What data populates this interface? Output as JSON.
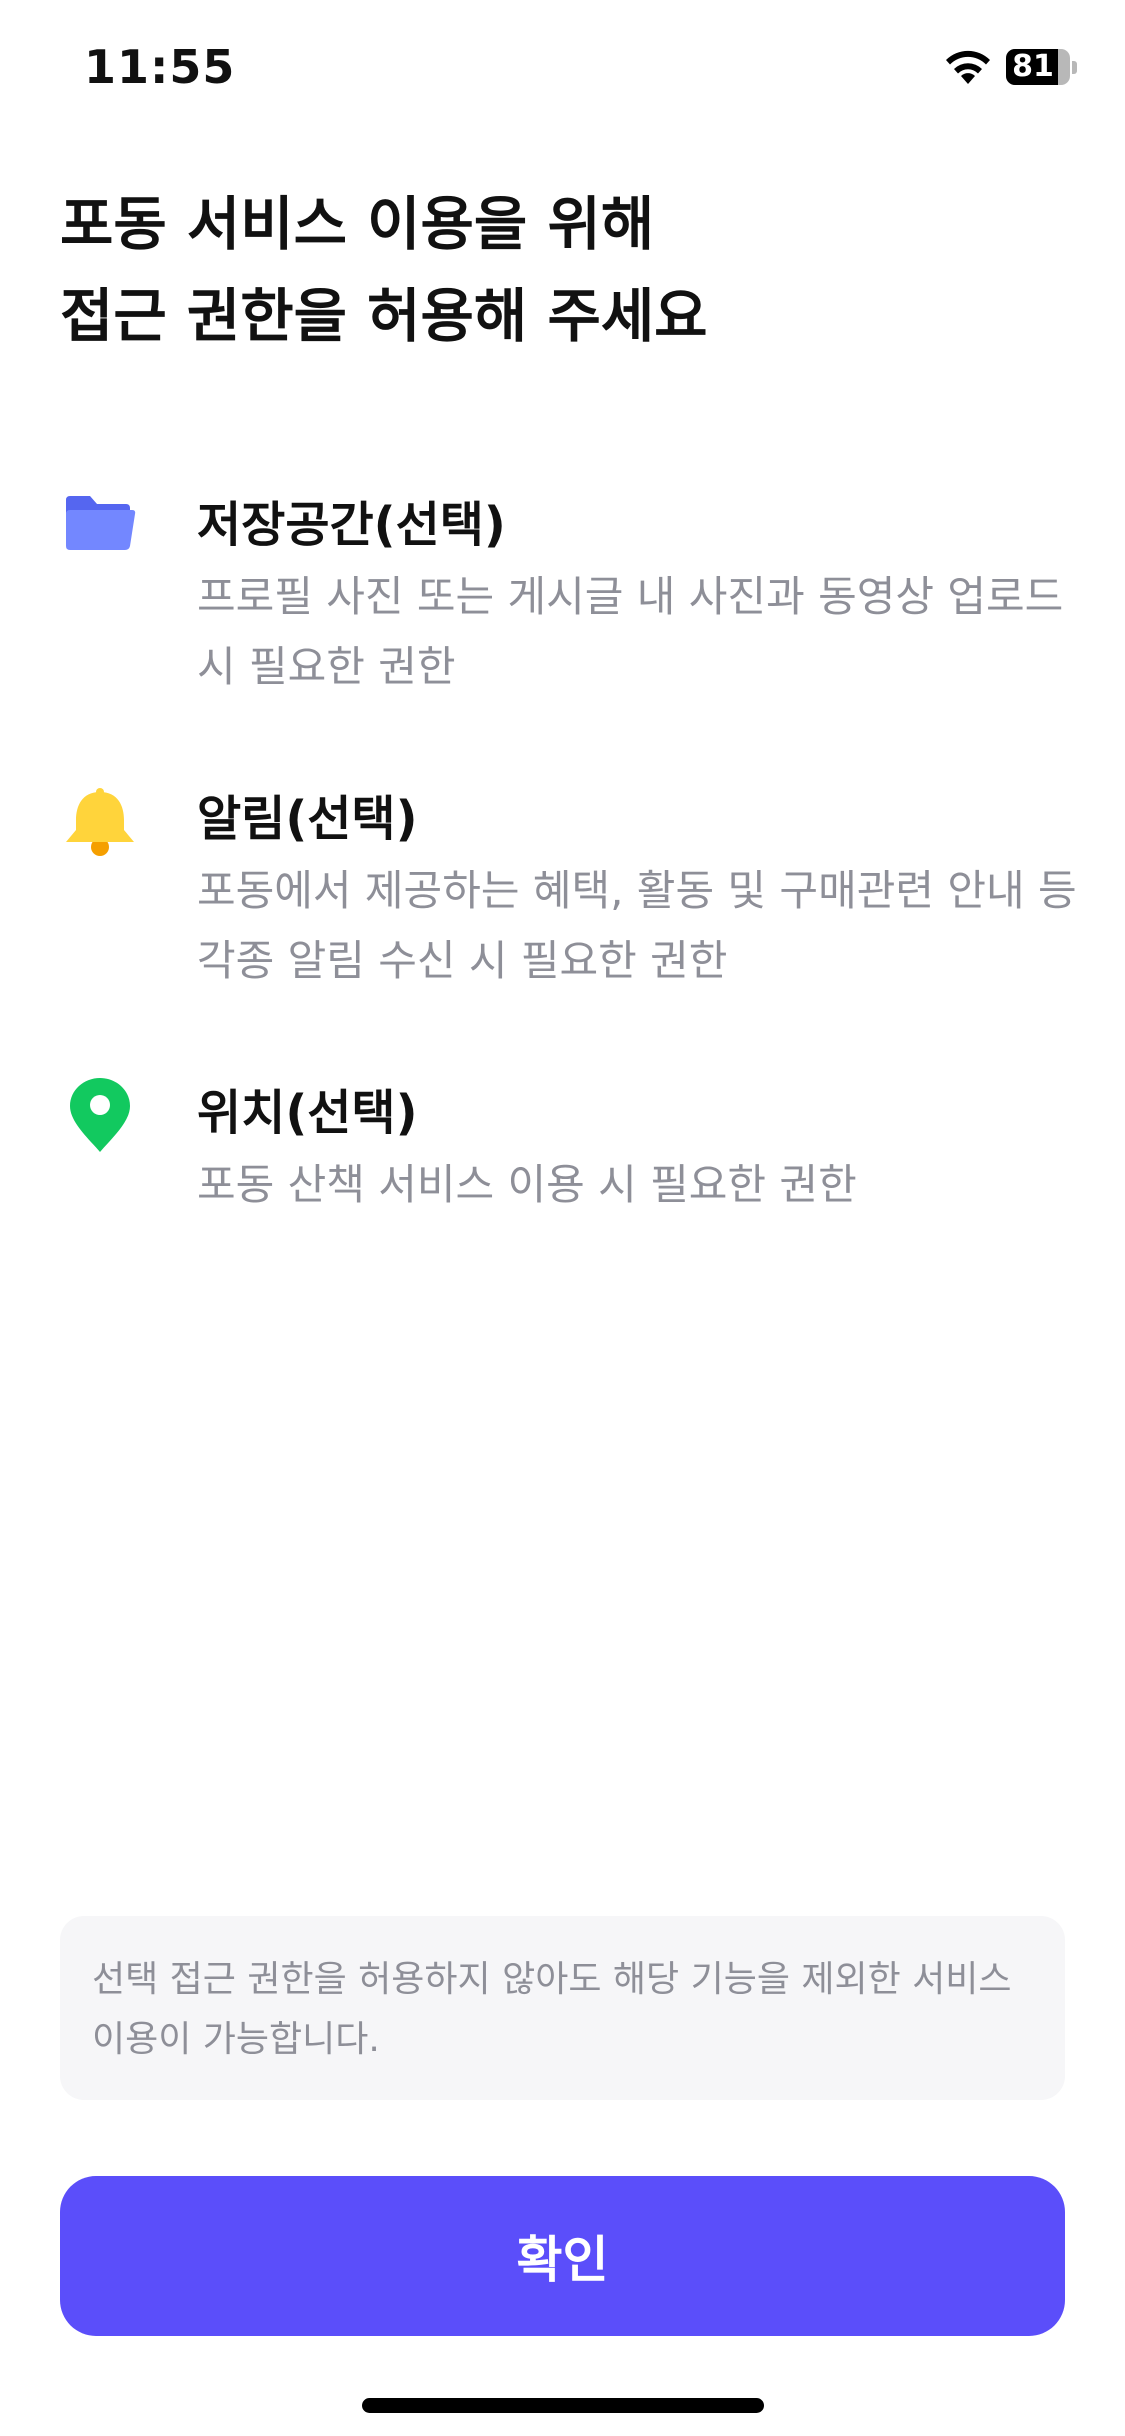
{
  "status_bar": {
    "time": "11:55",
    "battery_level": "81",
    "battery_fraction": 0.81
  },
  "title": {
    "line1": "포동 서비스 이용을 위해",
    "line2": "접근 권한을 허용해 주세요"
  },
  "permissions": [
    {
      "icon": "folder-icon",
      "title": "저장공간(선택)",
      "description": "프로필 사진 또는 게시글 내 사진과 동영상 업로드 시 필요한 권한"
    },
    {
      "icon": "bell-icon",
      "title": "알림(선택)",
      "description": "포동에서 제공하는 혜택, 활동 및 구매관련 안내 등 각종 알림 수신 시 필요한 권한"
    },
    {
      "icon": "location-pin-icon",
      "title": "위치(선택)",
      "description": "포동 산책 서비스 이용 시 필요한 권한"
    }
  ],
  "notice": {
    "text": "선택 접근 권한을 허용하지 않아도 해당 기능을 제외한 서비스 이용이 가능합니다."
  },
  "confirm_button": {
    "label": "확인"
  },
  "colors": {
    "accent": "#5b4efa",
    "folder": "#6b7cff",
    "bell": "#ffd43b",
    "bell_clapper": "#f59f00",
    "location": "#12c95f",
    "secondary_text": "#8e8f98",
    "notice_background": "#f6f6f8"
  }
}
